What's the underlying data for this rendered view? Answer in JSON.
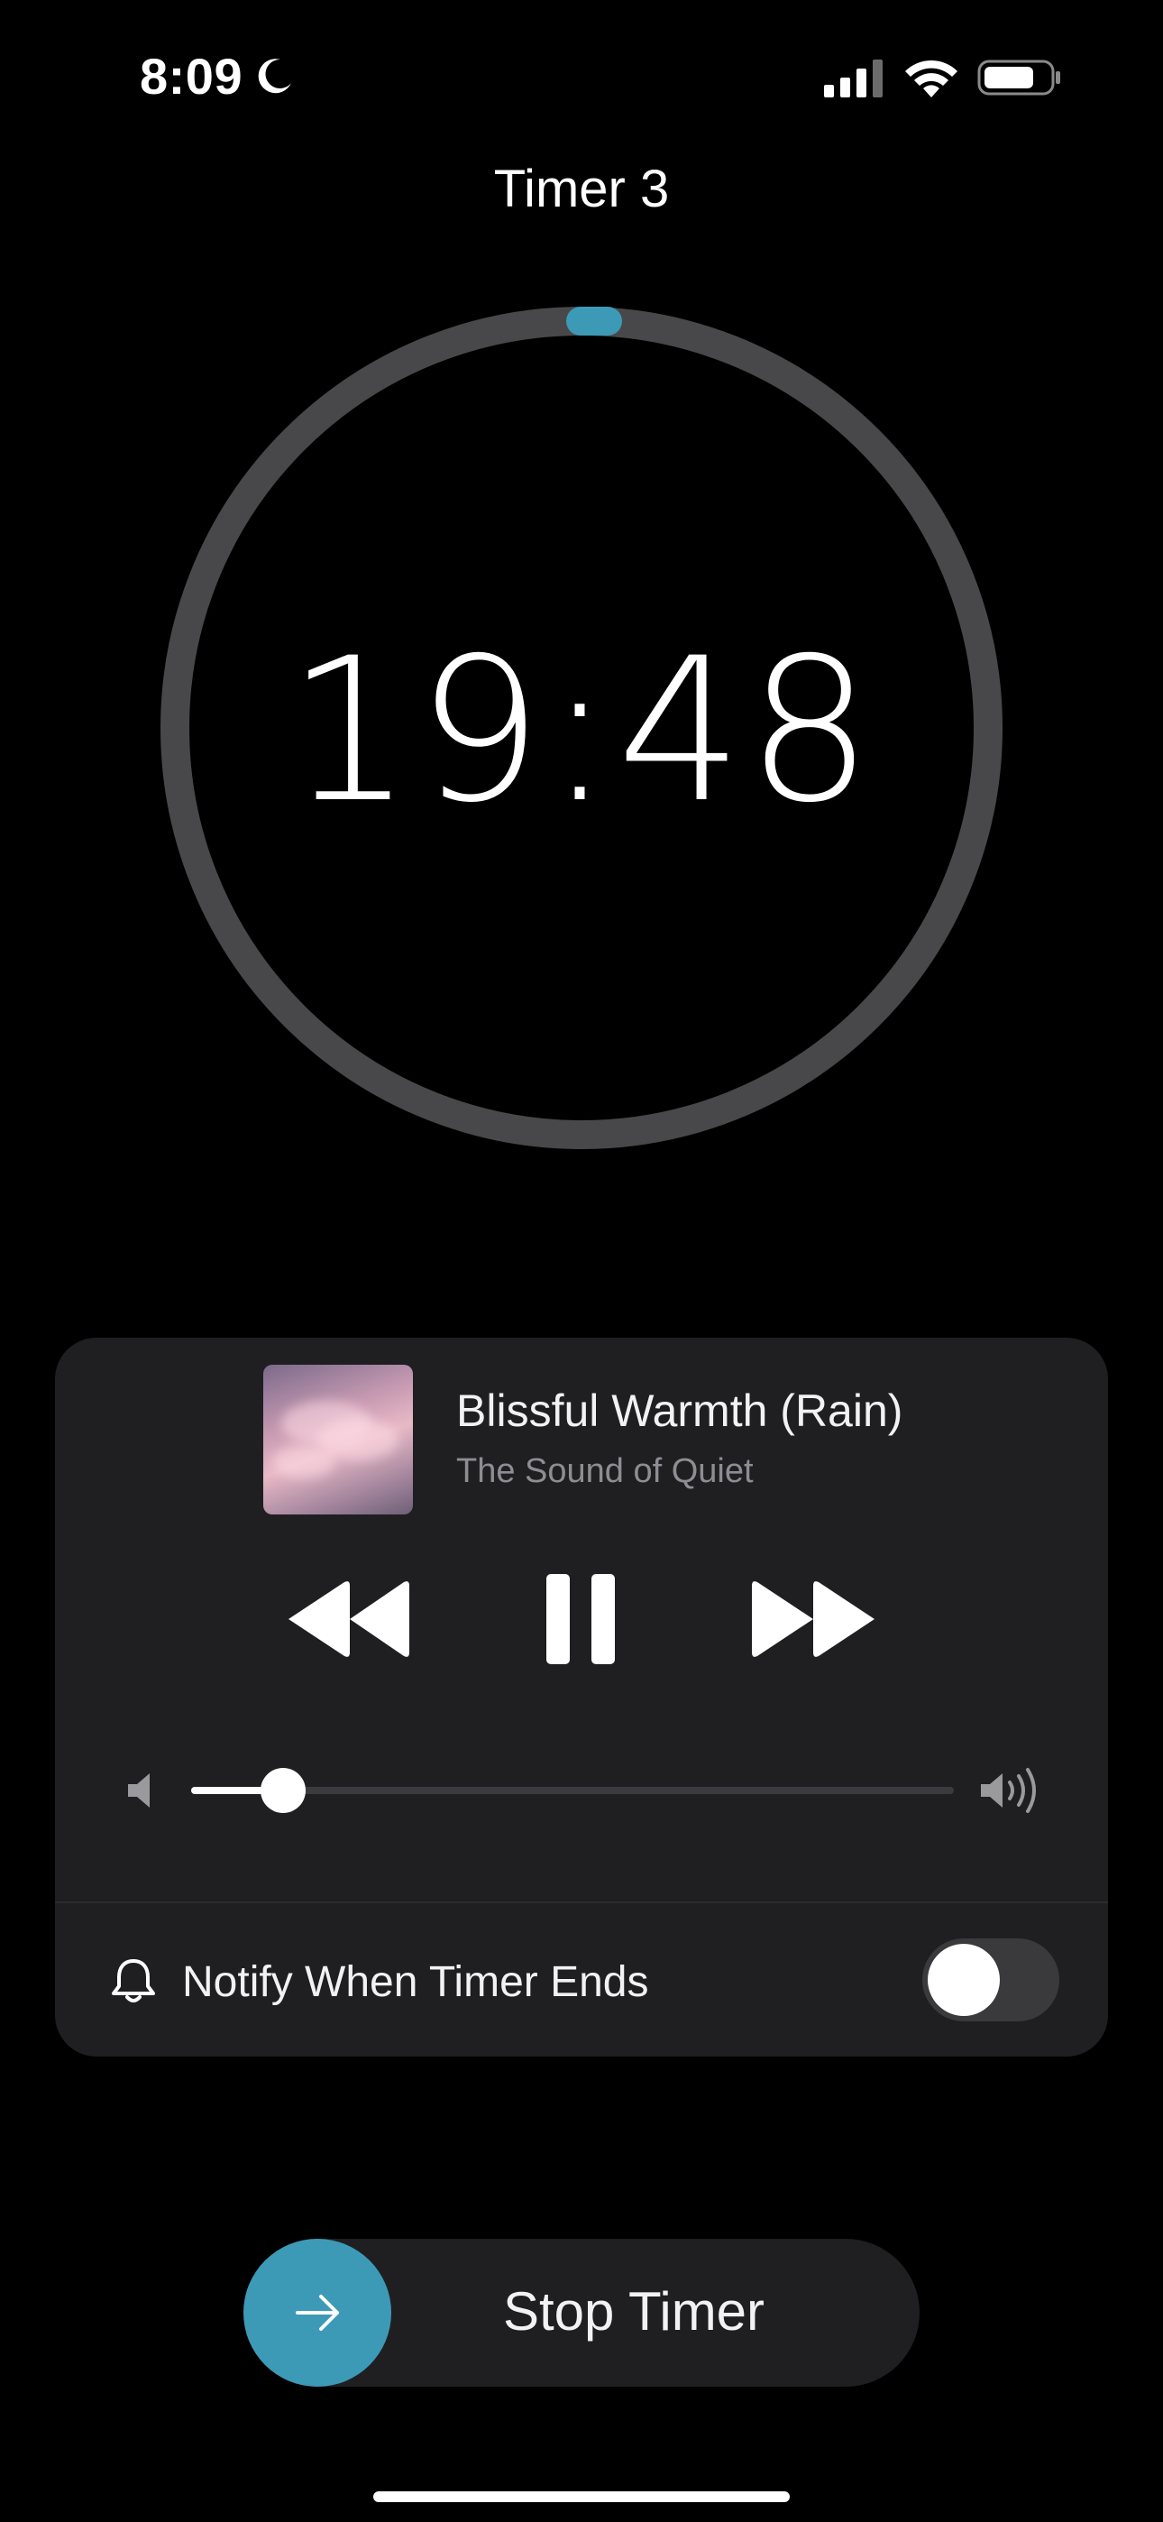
{
  "status_bar": {
    "time": "8:09",
    "focus_icon": "moon-icon",
    "signal_icon": "cellular-signal-icon",
    "wifi_icon": "wifi-icon",
    "battery_icon": "battery-icon"
  },
  "header": {
    "title": "Timer 3"
  },
  "timer": {
    "remaining": "19:48",
    "ring_color": "#4a4a4c",
    "progress_color": "#3d9ab6"
  },
  "player": {
    "track_title": "Blissful Warmth (Rain)",
    "artist": "The Sound of Quiet",
    "controls": [
      "rewind-icon",
      "pause-icon",
      "fast-forward-icon"
    ],
    "volume_level": 0.12
  },
  "notify": {
    "label": "Notify When Timer Ends",
    "enabled": false
  },
  "stop": {
    "label": "Stop Timer",
    "accent": "#3d9ab6"
  }
}
